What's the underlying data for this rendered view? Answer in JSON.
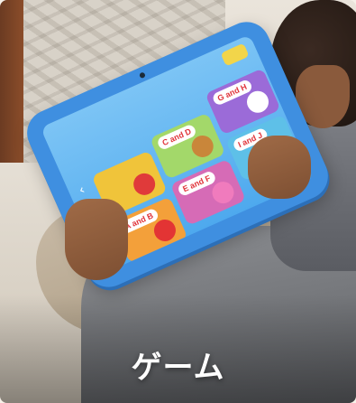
{
  "card": {
    "caption": "ゲーム"
  },
  "tablet": {
    "tiles": [
      {
        "bubble": ""
      },
      {
        "bubble": "C and D"
      },
      {
        "bubble": "G and H"
      },
      {
        "bubble": "A and B"
      },
      {
        "bubble": "E and F"
      },
      {
        "bubble": "I and J"
      }
    ]
  },
  "colors": {
    "tablet_case": "#3f8fe0",
    "screen_bg": "#4ea9ee",
    "caption_text": "#ffffff"
  }
}
